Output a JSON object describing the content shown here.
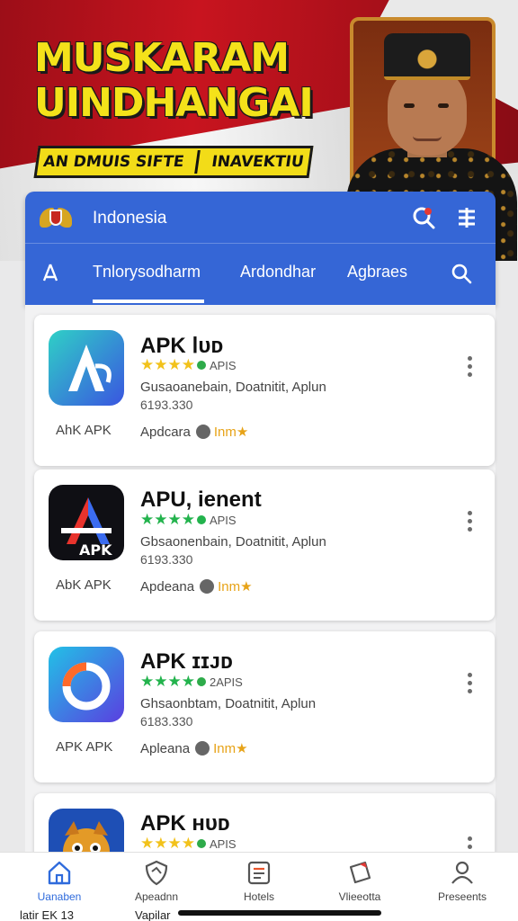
{
  "hero": {
    "title_line1": "MUSKARAM",
    "title_line2": "UINDHANGAI",
    "banner_left": "AN DMUIS SIFTE",
    "banner_right": "INAVEKTIU"
  },
  "header": {
    "country": "Indonesia",
    "tabs": [
      {
        "label": "Tnlorysodharm",
        "active": true
      },
      {
        "label": "Ardondhar",
        "active": false
      },
      {
        "label": "Agbraes",
        "active": false
      }
    ]
  },
  "apps": [
    {
      "name": "APK Ⅰᴜᴅ",
      "stars": "★★★★",
      "star_color": "#f2c21b",
      "dot_color": "#2eab4a",
      "size": "APIS",
      "desc": "Gusaoanebain, Doatnitit, Aplun",
      "meta": "6193.330",
      "label": "AhK APK",
      "sub": "Apdcara",
      "sub2": "Inm★",
      "icon": "apk-a-icon"
    },
    {
      "name": "APU, ienent",
      "stars": "★★★★",
      "star_color": "#23b34d",
      "dot_color": "#23b34d",
      "size": "APIS",
      "desc": "Gbsaonenbain, Doatnitit, Aplun",
      "meta": "6193.330",
      "label": "AbK APK",
      "sub": "Apdeana",
      "sub2": "Inm★",
      "icon": "apk-dark-icon"
    },
    {
      "name": "APK ɪɪᴊᴅ",
      "stars": "★★★★",
      "star_color": "#23b34d",
      "dot_color": "#2eab4a",
      "size": "2APIS",
      "desc": "Ghsaonbtam, Doatnitit, Aplun",
      "meta": "6183.330",
      "label": "APK APK",
      "sub": "Apleana",
      "sub2": "Inm★",
      "icon": "apk-circle-icon"
    },
    {
      "name": "APK ʜᴜᴅ",
      "stars": "★★★★",
      "star_color": "#f2c21b",
      "dot_color": "#2eab4a",
      "size": "APIS",
      "desc": "",
      "meta": "",
      "label": "",
      "sub": "",
      "sub2": "",
      "icon": "apk-mascot-icon"
    }
  ],
  "nav": [
    {
      "label": "Uanaben",
      "icon": "home-icon",
      "active": true
    },
    {
      "label": "Apeadnn",
      "icon": "shield-icon",
      "active": false
    },
    {
      "label": "Hotels",
      "icon": "list-icon",
      "active": false
    },
    {
      "label": "Vlieeotta",
      "icon": "paper-icon",
      "active": false
    },
    {
      "label": "Preseents",
      "icon": "user-icon",
      "active": false
    }
  ],
  "under_left": "latir EK 13",
  "under_mid": "Vapilar"
}
